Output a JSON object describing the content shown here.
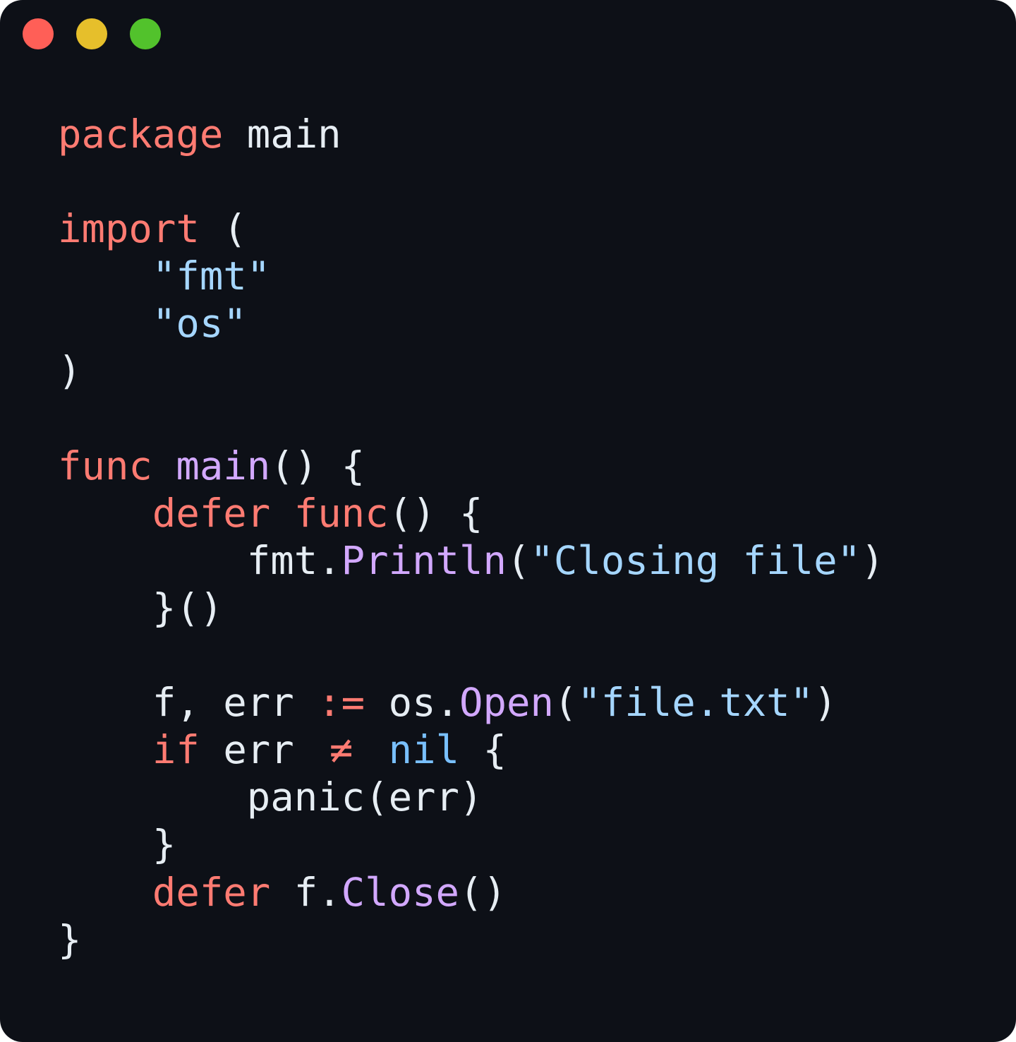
{
  "window": {
    "controls": [
      {
        "name": "close",
        "color": "#ff5f57"
      },
      {
        "name": "minimize",
        "color": "#e6bf2b"
      },
      {
        "name": "maximize",
        "color": "#52c22c"
      }
    ]
  },
  "colors": {
    "background": "#0d1017",
    "keyword": "#ff7b72",
    "plain": "#e6edf3",
    "function": "#d2a8ff",
    "string": "#a5d6ff",
    "constant": "#79c0ff"
  },
  "code": {
    "language": "go",
    "lines": [
      [
        {
          "t": "keyword",
          "v": "package"
        },
        {
          "t": "plain",
          "v": " main"
        }
      ],
      [],
      [
        {
          "t": "keyword",
          "v": "import"
        },
        {
          "t": "plain",
          "v": " ("
        }
      ],
      [
        {
          "t": "plain",
          "v": "    "
        },
        {
          "t": "string",
          "v": "\"fmt\""
        }
      ],
      [
        {
          "t": "plain",
          "v": "    "
        },
        {
          "t": "string",
          "v": "\"os\""
        }
      ],
      [
        {
          "t": "plain",
          "v": ")"
        }
      ],
      [],
      [
        {
          "t": "keyword",
          "v": "func"
        },
        {
          "t": "plain",
          "v": " "
        },
        {
          "t": "func",
          "v": "main"
        },
        {
          "t": "plain",
          "v": "() {"
        }
      ],
      [
        {
          "t": "plain",
          "v": "    "
        },
        {
          "t": "keyword",
          "v": "defer"
        },
        {
          "t": "plain",
          "v": " "
        },
        {
          "t": "keyword",
          "v": "func"
        },
        {
          "t": "plain",
          "v": "() {"
        }
      ],
      [
        {
          "t": "plain",
          "v": "        fmt."
        },
        {
          "t": "func",
          "v": "Println"
        },
        {
          "t": "plain",
          "v": "("
        },
        {
          "t": "string",
          "v": "\"Closing file\""
        },
        {
          "t": "plain",
          "v": ")"
        }
      ],
      [
        {
          "t": "plain",
          "v": "    }()"
        }
      ],
      [],
      [
        {
          "t": "plain",
          "v": "    f, err "
        },
        {
          "t": "op",
          "v": ":="
        },
        {
          "t": "plain",
          "v": " os."
        },
        {
          "t": "func",
          "v": "Open"
        },
        {
          "t": "plain",
          "v": "("
        },
        {
          "t": "string",
          "v": "\"file.txt\""
        },
        {
          "t": "plain",
          "v": ")"
        }
      ],
      [
        {
          "t": "plain",
          "v": "    "
        },
        {
          "t": "keyword",
          "v": "if"
        },
        {
          "t": "plain",
          "v": " err "
        },
        {
          "t": "op",
          "v": "≠",
          "lig": true
        },
        {
          "t": "plain",
          "v": " "
        },
        {
          "t": "const",
          "v": "nil"
        },
        {
          "t": "plain",
          "v": " {"
        }
      ],
      [
        {
          "t": "plain",
          "v": "        panic(err)"
        }
      ],
      [
        {
          "t": "plain",
          "v": "    }"
        }
      ],
      [
        {
          "t": "plain",
          "v": "    "
        },
        {
          "t": "keyword",
          "v": "defer"
        },
        {
          "t": "plain",
          "v": " f."
        },
        {
          "t": "func",
          "v": "Close"
        },
        {
          "t": "plain",
          "v": "()"
        }
      ],
      [
        {
          "t": "plain",
          "v": "}"
        }
      ]
    ]
  }
}
